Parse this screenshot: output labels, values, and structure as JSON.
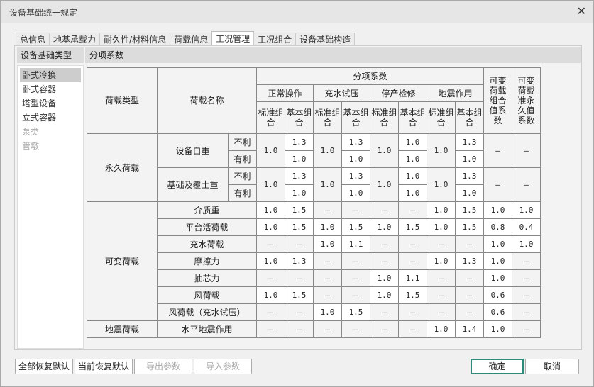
{
  "window": {
    "title": "设备基础统一规定",
    "close": "✕"
  },
  "tabs": [
    "总信息",
    "地基承载力",
    "耐久性/材料信息",
    "荷载信息",
    "工况管理",
    "工况组合",
    "设备基础构造"
  ],
  "active_tab": 4,
  "left": {
    "header": "设备基础类型",
    "items": [
      {
        "label": "卧式冷换",
        "state": "selected"
      },
      {
        "label": "卧式容器",
        "state": "normal"
      },
      {
        "label": "塔型设备",
        "state": "normal"
      },
      {
        "label": "立式容器",
        "state": "normal"
      },
      {
        "label": "泵类",
        "state": "disabled"
      },
      {
        "label": "管墩",
        "state": "disabled"
      }
    ]
  },
  "right": {
    "header": "分项系数"
  },
  "table": {
    "h_type": "荷载类型",
    "h_name": "荷载名称",
    "h_group": "分项系数",
    "cases": [
      "正常操作",
      "充水试压",
      "停产检修",
      "地震作用"
    ],
    "std": "标准组合",
    "basic": "基本组合",
    "h_psi_c": "可变荷载组合值系数",
    "h_psi_q": "可变荷载准永久值系数",
    "permanent": {
      "type": "永久荷载",
      "loads": [
        {
          "name": "设备自重",
          "unfav": "不利",
          "fav": "有利",
          "std": [
            "1.0",
            "1.0",
            "1.0",
            "1.0"
          ],
          "basic_unfav": [
            "1.3",
            "1.3",
            "1.0",
            "1.3"
          ],
          "basic_fav": [
            "1.0",
            "1.0",
            "1.0",
            "1.0"
          ],
          "psi_c": "–",
          "psi_q": "–"
        },
        {
          "name": "基础及覆土重",
          "unfav": "不利",
          "fav": "有利",
          "std": [
            "1.0",
            "1.0",
            "1.0",
            "1.0"
          ],
          "basic_unfav": [
            "1.3",
            "1.3",
            "1.0",
            "1.3"
          ],
          "basic_fav": [
            "1.0",
            "1.0",
            "1.0",
            "1.0"
          ],
          "psi_c": "–",
          "psi_q": "–"
        }
      ]
    },
    "variable": {
      "type": "可变荷载",
      "loads": [
        {
          "name": "介质重",
          "values": [
            "1.0",
            "1.5",
            "–",
            "–",
            "–",
            "–",
            "1.0",
            "1.5",
            "1.0",
            "1.0"
          ]
        },
        {
          "name": "平台活荷载",
          "values": [
            "1.0",
            "1.5",
            "1.0",
            "1.5",
            "1.0",
            "1.5",
            "1.0",
            "1.5",
            "0.8",
            "0.4"
          ]
        },
        {
          "name": "充水荷载",
          "values": [
            "–",
            "–",
            "1.0",
            "1.1",
            "–",
            "–",
            "–",
            "–",
            "1.0",
            "1.0"
          ]
        },
        {
          "name": "摩擦力",
          "values": [
            "1.0",
            "1.3",
            "–",
            "–",
            "–",
            "–",
            "1.0",
            "1.3",
            "1.0",
            "–"
          ]
        },
        {
          "name": "抽芯力",
          "values": [
            "–",
            "–",
            "–",
            "–",
            "1.0",
            "1.1",
            "–",
            "–",
            "1.0",
            "–"
          ]
        },
        {
          "name": "风荷载",
          "values": [
            "1.0",
            "1.5",
            "–",
            "–",
            "1.0",
            "1.5",
            "–",
            "–",
            "0.6",
            "–"
          ]
        },
        {
          "name": "风荷载（充水试压）",
          "values": [
            "–",
            "–",
            "1.0",
            "1.5",
            "–",
            "–",
            "–",
            "–",
            "0.6",
            "–"
          ]
        }
      ]
    },
    "seismic": {
      "type": "地震荷载",
      "loads": [
        {
          "name": "水平地震作用",
          "values": [
            "–",
            "–",
            "–",
            "–",
            "–",
            "–",
            "1.0",
            "1.4",
            "1.0",
            "–"
          ]
        }
      ]
    }
  },
  "buttons": {
    "restore_all": "全部恢复默认",
    "restore_current": "当前恢复默认",
    "export": "导出参数",
    "import": "导入参数",
    "ok": "确定",
    "cancel": "取消"
  }
}
